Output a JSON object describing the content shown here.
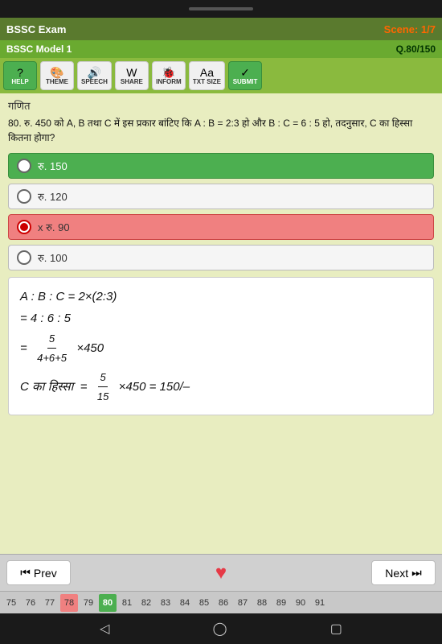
{
  "device": {
    "top_bar_label": ""
  },
  "header": {
    "exam_title": "BSSC Exam",
    "scene_label": "Scene: 1/7",
    "model_label": "BSSC Model 1",
    "q_score": "Q.80/150"
  },
  "toolbar": {
    "help_label": "Help",
    "theme_label": "THEME",
    "speech_label": "SPEECH",
    "share_label": "SHARE",
    "inform_label": "INFORM",
    "txt_size_label": "TXT SIZE",
    "submit_label": "SUBMIT"
  },
  "question": {
    "category": "गणित",
    "text": "80. रु. 450 को A, B तथा C में इस प्रकार बांटिए कि A : B = 2:3 हो और B : C = 6 : 5 हो, तदनुसार, C का हिस्सा कितना होगा?",
    "options": [
      {
        "id": "a",
        "text": "रु. 150",
        "state": "correct"
      },
      {
        "id": "b",
        "text": "रु. 120",
        "state": "neutral"
      },
      {
        "id": "c",
        "text": "x रु. 90",
        "state": "wrong"
      },
      {
        "id": "d",
        "text": "रु. 100",
        "state": "neutral"
      }
    ]
  },
  "solution": {
    "line1": "A : B : C = 2×(2:3)",
    "line2": "= 4 : 6 : 5",
    "line3_prefix": "=",
    "line3_num": "5",
    "line3_den": "4+6+5",
    "line3_suffix": "×450",
    "line4_prefix": "C का हिस्सा",
    "line4_frac_num": "5",
    "line4_frac_den": "15",
    "line4_suffix": "×450 = 150/–"
  },
  "bottom_nav": {
    "prev_label": "Prev",
    "next_label": "Next",
    "heart_icon": "♥"
  },
  "qnum_strip": {
    "numbers": [
      "75",
      "76",
      "77",
      "78",
      "79",
      "80",
      "81",
      "82",
      "83",
      "84",
      "85",
      "86",
      "87",
      "88",
      "89",
      "90",
      "91"
    ],
    "current": "80",
    "wrong_nums": [
      "78"
    ]
  },
  "android_nav": {
    "back_icon": "◁",
    "home_icon": "◯",
    "recent_icon": "▢"
  }
}
